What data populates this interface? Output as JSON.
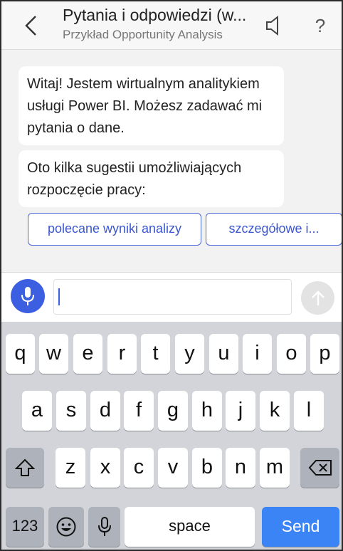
{
  "header": {
    "title": "Pytania i odpowiedzi (w...",
    "subtitle": "Przykład Opportunity Analysis",
    "help_label": "?"
  },
  "chat": {
    "messages": [
      {
        "text": "Witaj! Jestem wirtualnym analitykiem usługi Power BI. Możesz zadawać mi pytania o dane."
      },
      {
        "text": "Oto kilka sugestii umożliwiających rozpoczęcie pracy:"
      }
    ],
    "suggestions": [
      {
        "label": "polecane wyniki analizy"
      },
      {
        "label": "szczegółowe i..."
      }
    ]
  },
  "input": {
    "value": ""
  },
  "keyboard": {
    "row1": [
      "q",
      "w",
      "e",
      "r",
      "t",
      "y",
      "u",
      "i",
      "o",
      "p"
    ],
    "row2": [
      "a",
      "s",
      "d",
      "f",
      "g",
      "h",
      "j",
      "k",
      "l"
    ],
    "row3": [
      "z",
      "x",
      "c",
      "v",
      "b",
      "n",
      "m"
    ],
    "numbers_label": "123",
    "space_label": "space",
    "send_label": "Send"
  },
  "colors": {
    "accent": "#3b5fe0",
    "send_key": "#3a84f5",
    "keyboard_bg": "#d2d4d9"
  }
}
